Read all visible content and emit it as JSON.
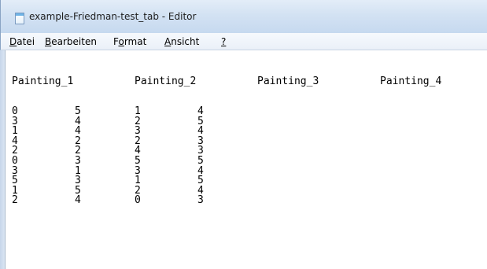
{
  "window": {
    "title": "example-Friedman-test_tab - Editor",
    "icon": "notepad-icon"
  },
  "menubar": {
    "items": [
      {
        "label_prefix": "",
        "accel": "D",
        "label_suffix": "atei"
      },
      {
        "label_prefix": "",
        "accel": "B",
        "label_suffix": "earbeiten"
      },
      {
        "label_prefix": "F",
        "accel": "o",
        "label_suffix": "rmat"
      },
      {
        "label_prefix": "",
        "accel": "A",
        "label_suffix": "nsicht"
      },
      {
        "label_prefix": "",
        "accel": "?",
        "label_suffix": ""
      }
    ]
  },
  "document": {
    "headers": [
      "Painting_1",
      "Painting_2",
      "Painting_3",
      "Painting_4"
    ],
    "rows": [
      [
        "0",
        "5",
        "1",
        "4"
      ],
      [
        "3",
        "4",
        "2",
        "5"
      ],
      [
        "1",
        "4",
        "3",
        "4"
      ],
      [
        "4",
        "2",
        "2",
        "3"
      ],
      [
        "2",
        "2",
        "4",
        "3"
      ],
      [
        "0",
        "3",
        "5",
        "5"
      ],
      [
        "3",
        "1",
        "3",
        "4"
      ],
      [
        "5",
        "3",
        "1",
        "5"
      ],
      [
        "1",
        "5",
        "2",
        "4"
      ],
      [
        "2",
        "4",
        "0",
        "3"
      ]
    ]
  }
}
